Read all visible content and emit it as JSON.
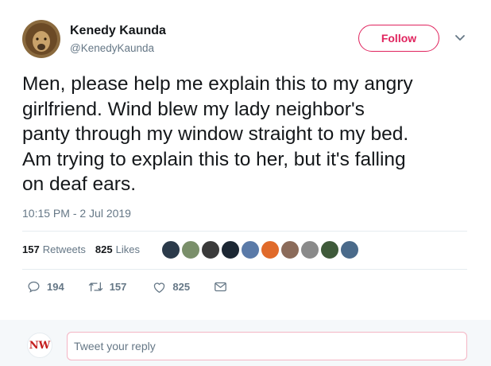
{
  "author": {
    "name": "Kenedy Kaunda",
    "handle": "@KenedyKaunda"
  },
  "follow_label": "Follow",
  "tweet": {
    "lines": [
      "Men, please help me explain this to my angry",
      "girlfriend. Wind blew my lady neighbor's",
      "panty through my window straight to my bed.",
      "Am trying to explain this to her, but it's falling",
      "on deaf ears."
    ],
    "timestamp": "10:15 PM - 2 Jul 2019"
  },
  "stats": {
    "retweets_count": "157",
    "retweets_label": "Retweets",
    "likes_count": "825",
    "likes_label": "Likes"
  },
  "liker_avatars": [
    "#2b3a4a",
    "#7a8f6a",
    "#3a3a3a",
    "#1c2733",
    "#5a7aa8",
    "#e06a2a",
    "#8b6b5a",
    "#8a8a8a",
    "#3f5a3a",
    "#4a6a8a"
  ],
  "actions": {
    "reply_count": "194",
    "retweet_count": "157",
    "like_count": "825"
  },
  "reply": {
    "avatar_text": "NW",
    "placeholder": "Tweet your reply"
  },
  "colors": {
    "accent": "#e0245e",
    "secondary_text": "#657786"
  }
}
